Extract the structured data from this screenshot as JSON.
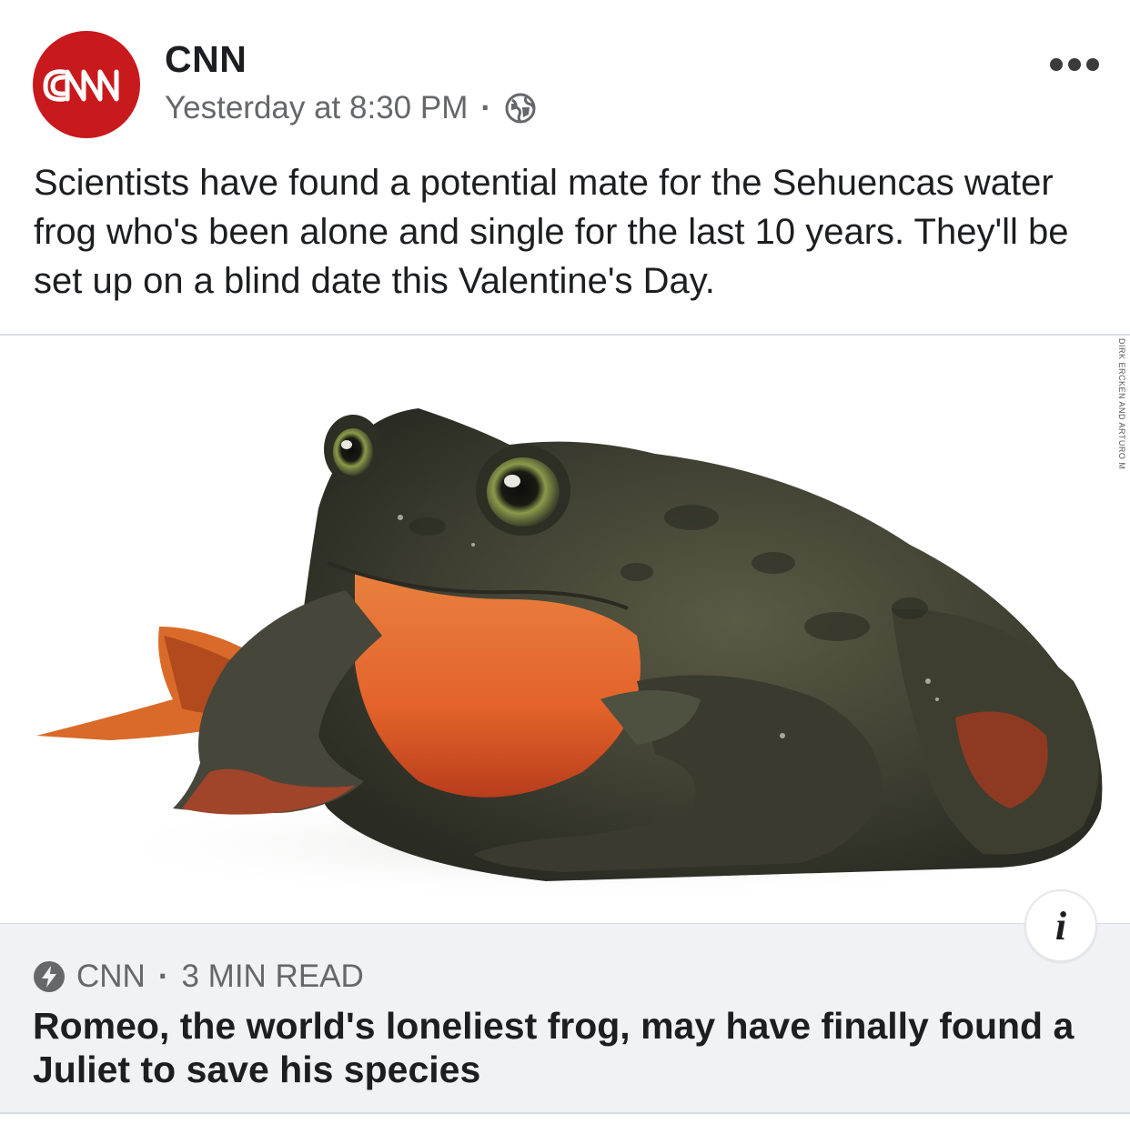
{
  "post": {
    "page_name": "CNN",
    "avatar_logo_text": "CNN",
    "timestamp": "Yesterday at 8:30 PM",
    "separator": "·",
    "privacy_icon": "globe-icon",
    "more_icon": "more-options-icon",
    "text": "Scientists have found a potential mate for the Sehuencas water frog who's been alone and single for the last 10 years. They'll be set up on a blind date this Valentine's Day."
  },
  "link": {
    "image_subject": "Sehuencas water frog",
    "photo_credit": "DIRK ERCKEN AND ARTURO M",
    "info_icon_glyph": "i",
    "source_icon": "instant-article-bolt-icon",
    "source": "CNN",
    "separator": "·",
    "read_time": "3 MIN READ",
    "title": "Romeo, the world's loneliest frog, may have finally found a Juliet to save his species"
  },
  "colors": {
    "cnn_red": "#c8191d",
    "text_primary": "#1c1e21",
    "text_secondary": "#65676b",
    "preview_bg": "#f0f2f5"
  }
}
